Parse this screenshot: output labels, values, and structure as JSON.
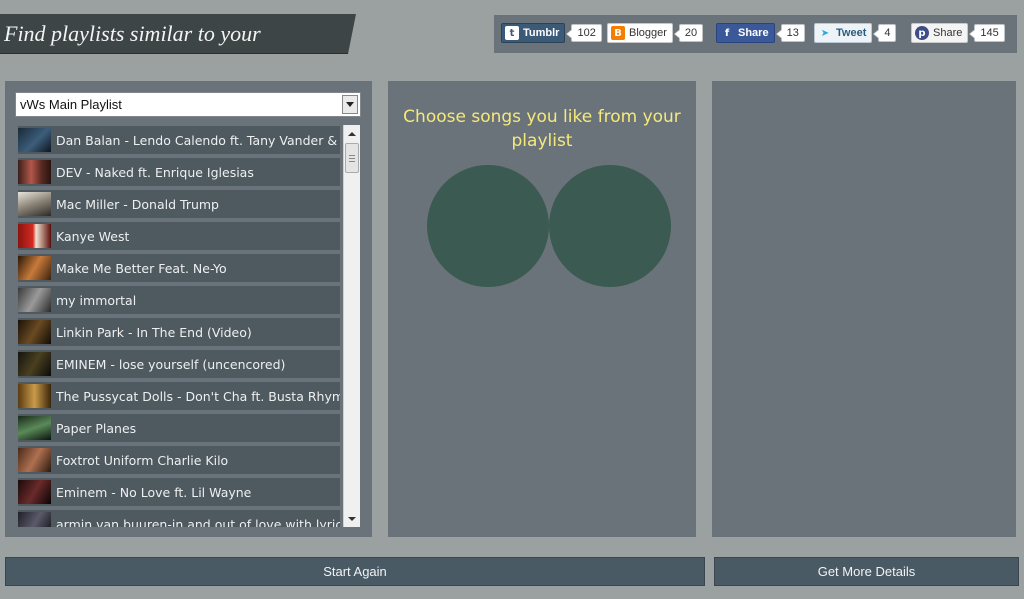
{
  "header": {
    "title": "Find playlists similar to your"
  },
  "share": [
    {
      "name": "Tumblr",
      "count": "102",
      "icon": "tumblr-icon"
    },
    {
      "name": "Blogger",
      "count": "20",
      "icon": "blogger-icon"
    },
    {
      "name": "Share",
      "count": "13",
      "icon": "facebook-icon"
    },
    {
      "name": "Tweet",
      "count": "4",
      "icon": "twitter-icon"
    },
    {
      "name": "Share",
      "count": "145",
      "icon": "pinterest-icon"
    }
  ],
  "playlist": {
    "selected": "vWs Main Playlist",
    "songs": [
      "Dan Balan - Lendo Calendo ft. Tany Vander &",
      "DEV - Naked ft. Enrique Iglesias",
      "Mac Miller - Donald Trump",
      "Kanye West",
      "Make Me Better Feat. Ne-Yo",
      "my immortal",
      "Linkin Park - In The End (Video)",
      "EMINEM - lose yourself (uncencored)",
      "The Pussycat Dolls - Don't Cha ft. Busta Rhymes",
      "Paper Planes",
      "Foxtrot Uniform Charlie Kilo",
      "Eminem - No Love ft. Lil Wayne",
      "armin van buuren-in and out of love with lyrics"
    ]
  },
  "middle": {
    "prompt": "Choose songs you like from your playlist"
  },
  "buttons": {
    "start_again": "Start Again",
    "get_more_details": "Get More Details"
  },
  "colors": {
    "background": "#9ba1a1",
    "panel": "#6a737a",
    "accent_text": "#f5e97a",
    "circle": "#3a5a52"
  }
}
